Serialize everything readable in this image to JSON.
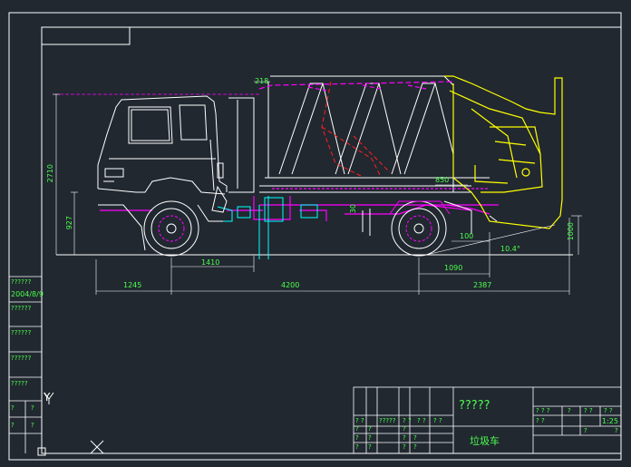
{
  "colors": {
    "background": "#212830",
    "frame": "#ffffff",
    "truck_cab": "#ffffff",
    "magenta": "#ff00ff",
    "yellow": "#ffff00",
    "red": "#ff2020",
    "cyan": "#00ffff",
    "dimension_text": "#4cff4c"
  },
  "dimensions": {
    "d_218": "218",
    "d_2710": "2710",
    "d_927": "927",
    "d_1410": "1410",
    "d_1245": "1245",
    "d_4200": "4200",
    "d_2387": "2387",
    "d_1090": "1090",
    "d_100": "100",
    "d_1000": "1000",
    "d_850": "850",
    "d_angle": "10.4°",
    "d_30": "30"
  },
  "left_strip": {
    "rows": [
      "??????",
      "2004/8/9",
      "??????",
      "??????",
      "??????",
      "?????",
      "?",
      "?",
      "?",
      "?"
    ]
  },
  "title_block": {
    "project_name": "?????",
    "drawing_name": "垃圾车",
    "scale": "1:25",
    "mid_row": [
      "? ?",
      "?????",
      "? ?",
      "? ?",
      "? ?"
    ],
    "small_q": "?",
    "right_header": [
      "? ? ?",
      "?",
      "? ?",
      "? ?",
      "? ?"
    ]
  },
  "ucs": {
    "y_label": "Y",
    "x_label": "X"
  }
}
